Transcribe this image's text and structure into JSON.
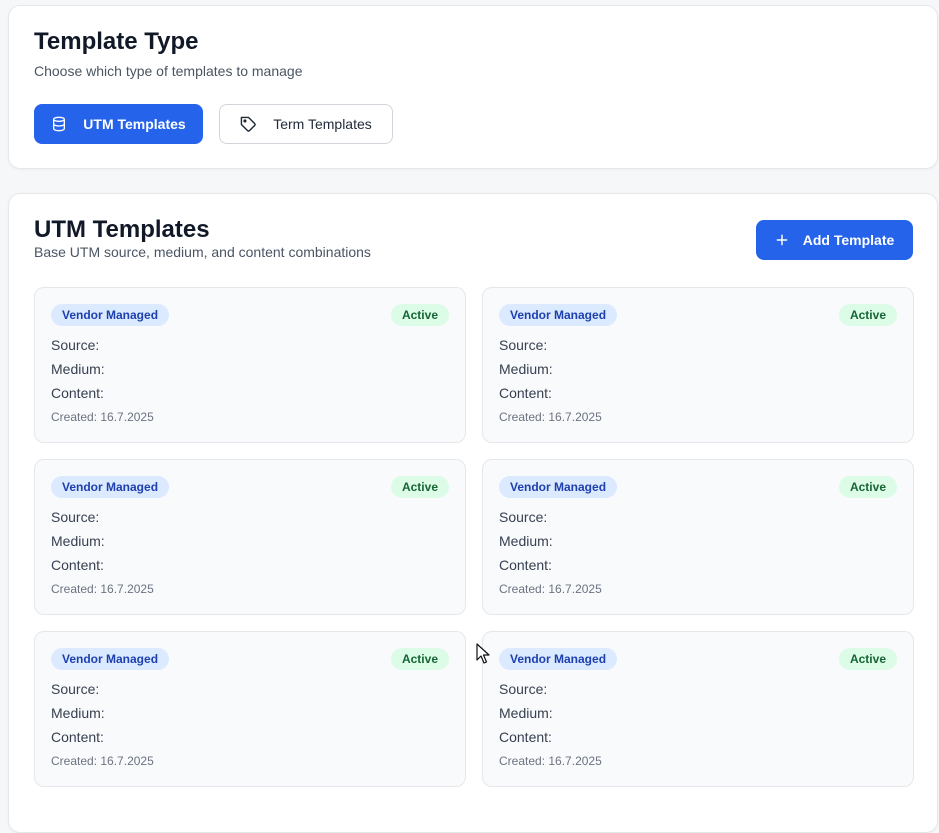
{
  "type_section": {
    "title": "Template Type",
    "subtitle": "Choose which type of templates to manage",
    "utm_button_label": "UTM Templates",
    "term_button_label": "Term Templates",
    "utm_icon": "database-icon",
    "term_icon": "tag-icon"
  },
  "utm_section": {
    "title": "UTM Templates",
    "subtitle": "Base UTM source, medium, and content combinations",
    "add_button_label": "Add Template",
    "add_icon": "plus-icon"
  },
  "templates": [
    {
      "badge": "Vendor Managed",
      "status": "Active",
      "source_label": "Source:",
      "medium_label": "Medium:",
      "content_label": "Content:",
      "created_label": "Created:",
      "created_date": "16.7.2025"
    },
    {
      "badge": "Vendor Managed",
      "status": "Active",
      "source_label": "Source:",
      "medium_label": "Medium:",
      "content_label": "Content:",
      "created_label": "Created:",
      "created_date": "16.7.2025"
    },
    {
      "badge": "Vendor Managed",
      "status": "Active",
      "source_label": "Source:",
      "medium_label": "Medium:",
      "content_label": "Content:",
      "created_label": "Created:",
      "created_date": "16.7.2025"
    },
    {
      "badge": "Vendor Managed",
      "status": "Active",
      "source_label": "Source:",
      "medium_label": "Medium:",
      "content_label": "Content:",
      "created_label": "Created:",
      "created_date": "16.7.2025"
    },
    {
      "badge": "Vendor Managed",
      "status": "Active",
      "source_label": "Source:",
      "medium_label": "Medium:",
      "content_label": "Content:",
      "created_label": "Created:",
      "created_date": "16.7.2025"
    },
    {
      "badge": "Vendor Managed",
      "status": "Active",
      "source_label": "Source:",
      "medium_label": "Medium:",
      "content_label": "Content:",
      "created_label": "Created:",
      "created_date": "16.7.2025"
    }
  ],
  "colors": {
    "primary": "#2563eb",
    "vendor_badge_bg": "#dbeafe",
    "vendor_badge_text": "#1e40af",
    "active_badge_bg": "#dcfce7",
    "active_badge_text": "#166534"
  }
}
